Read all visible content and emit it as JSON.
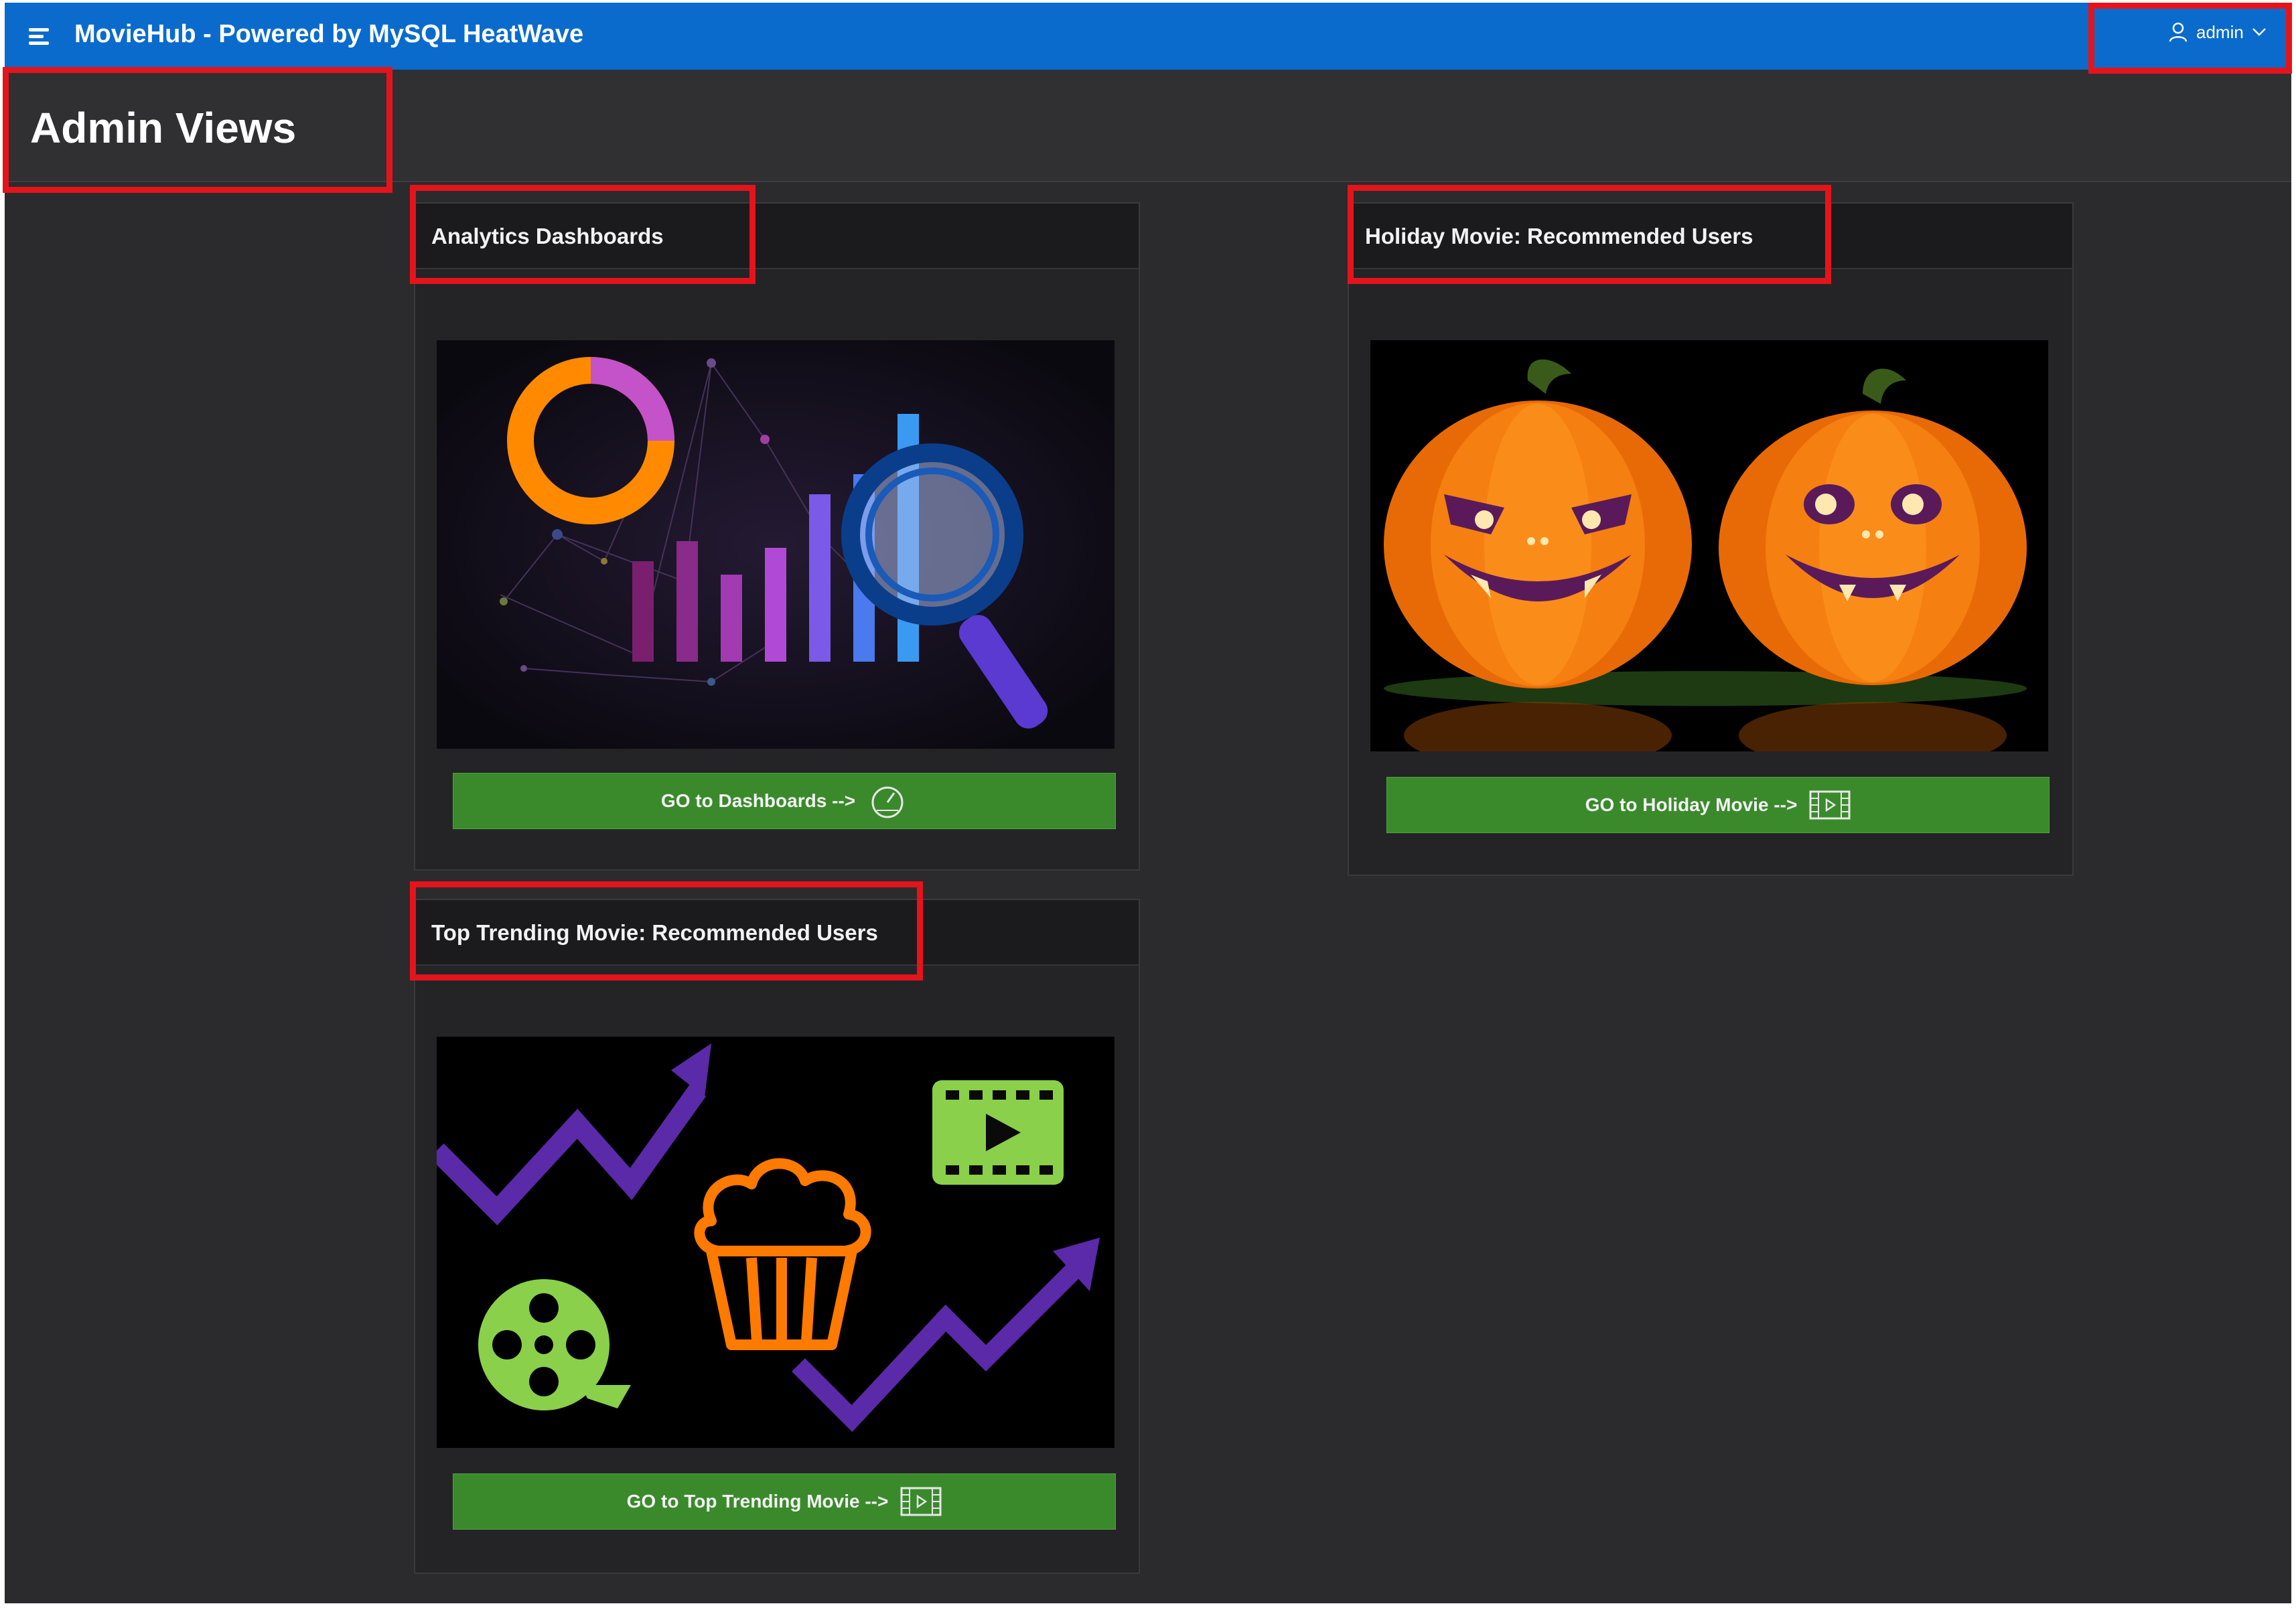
{
  "header": {
    "app_title": "MovieHub - Powered by MySQL HeatWave",
    "username": "admin",
    "icons": [
      "hamburger-icon",
      "user-icon",
      "chevron-down-icon"
    ]
  },
  "page": {
    "title": "Admin Views"
  },
  "cards": [
    {
      "title": "Analytics Dashboards",
      "button_label": "GO to Dashboards -->",
      "button_icon": "gauge-icon",
      "image": "analytics-chart-illustration"
    },
    {
      "title": "Holiday Movie: Recommended Users",
      "button_label": "GO to Holiday Movie -->",
      "button_icon": "film-play-icon",
      "image": "halloween-pumpkins"
    },
    {
      "title": "Top Trending Movie: Recommended Users",
      "button_label": "GO to Top Trending Movie -->",
      "button_icon": "film-play-icon",
      "image": "trending-movie-neon-icons"
    }
  ],
  "colors": {
    "topbar": "#0a6bcc",
    "background": "#2b2b2e",
    "button": "#3a8a2c",
    "highlight": "#e5141b"
  }
}
